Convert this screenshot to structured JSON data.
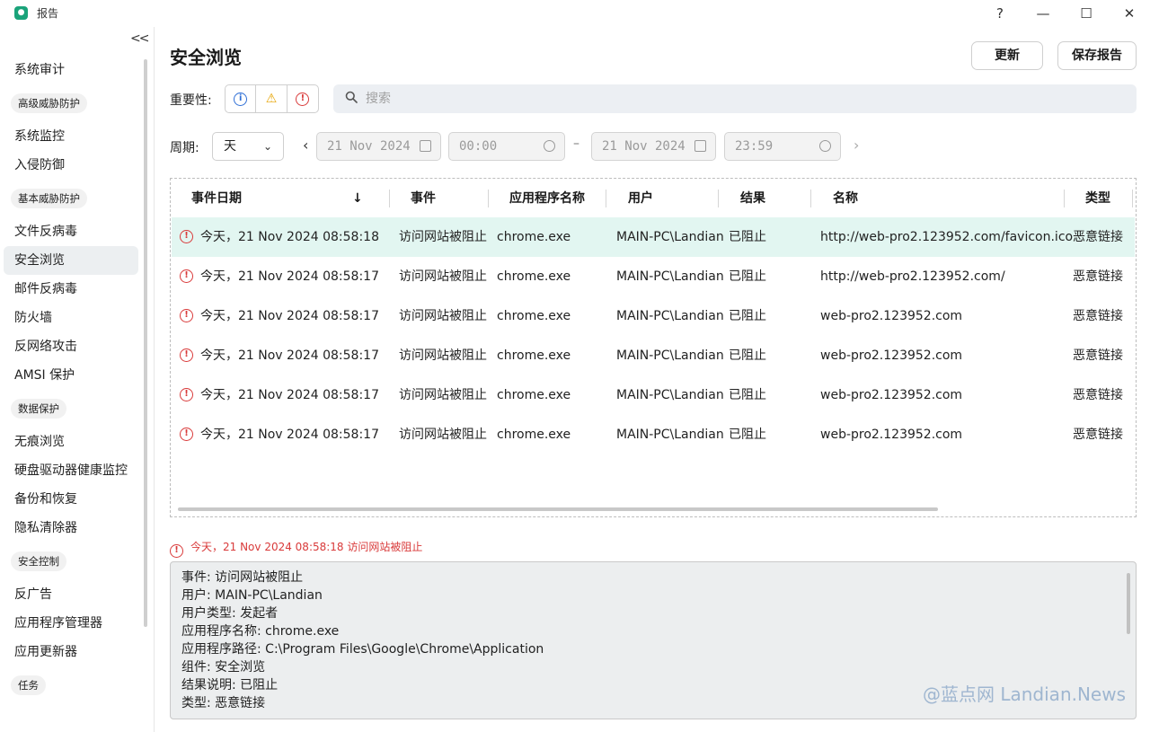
{
  "window": {
    "title": "报告",
    "help": "?",
    "minimize": "—",
    "maximize": "☐",
    "close": "✕"
  },
  "sidebar": {
    "collapse": "<<",
    "items": [
      {
        "type": "item",
        "label": "系统审计"
      },
      {
        "type": "group",
        "label": "高级威胁防护"
      },
      {
        "type": "item",
        "label": "系统监控"
      },
      {
        "type": "item",
        "label": "入侵防御"
      },
      {
        "type": "group",
        "label": "基本威胁防护"
      },
      {
        "type": "item",
        "label": "文件反病毒"
      },
      {
        "type": "item",
        "label": "安全浏览",
        "active": true
      },
      {
        "type": "item",
        "label": "邮件反病毒"
      },
      {
        "type": "item",
        "label": "防火墙"
      },
      {
        "type": "item",
        "label": "反网络攻击"
      },
      {
        "type": "item",
        "label": "AMSI 保护"
      },
      {
        "type": "group",
        "label": "数据保护"
      },
      {
        "type": "item",
        "label": "无痕浏览"
      },
      {
        "type": "item",
        "label": "硬盘驱动器健康监控"
      },
      {
        "type": "item",
        "label": "备份和恢复"
      },
      {
        "type": "item",
        "label": "隐私清除器"
      },
      {
        "type": "group",
        "label": "安全控制"
      },
      {
        "type": "item",
        "label": "反广告"
      },
      {
        "type": "item",
        "label": "应用程序管理器"
      },
      {
        "type": "item",
        "label": "应用更新器"
      },
      {
        "type": "group",
        "label": "任务"
      }
    ]
  },
  "main": {
    "title": "安全浏览",
    "refresh_label": "更新",
    "save_label": "保存报告",
    "severity_label": "重要性:",
    "severity_info": "i",
    "severity_warning": "⚠",
    "severity_error": "!",
    "search_placeholder": "搜索",
    "period_label": "周期:",
    "period_value": "天",
    "period_chevron": "⌄",
    "prev": "‹",
    "next": "›",
    "start_date": "21 Nov 2024",
    "start_time": "00:00",
    "end_date": "21 Nov 2024",
    "end_time": "23:59",
    "range_dash": "–"
  },
  "table": {
    "columns": {
      "date": "事件日期",
      "sort": "↓",
      "event": "事件",
      "app": "应用程序名称",
      "user": "用户",
      "result": "结果",
      "name": "名称",
      "type": "类型"
    },
    "rows": [
      {
        "date": "今天，21 Nov 2024 08:58:18",
        "event": "访问网站被阻止",
        "app": "chrome.exe",
        "user": "MAIN-PC\\Landian",
        "result": "已阻止",
        "name": "http://web-pro2.123952.com/favicon.ico",
        "type": "恶意链接"
      },
      {
        "date": "今天，21 Nov 2024 08:58:17",
        "event": "访问网站被阻止",
        "app": "chrome.exe",
        "user": "MAIN-PC\\Landian",
        "result": "已阻止",
        "name": "http://web-pro2.123952.com/",
        "type": "恶意链接"
      },
      {
        "date": "今天，21 Nov 2024 08:58:17",
        "event": "访问网站被阻止",
        "app": "chrome.exe",
        "user": "MAIN-PC\\Landian",
        "result": "已阻止",
        "name": "web-pro2.123952.com",
        "type": "恶意链接"
      },
      {
        "date": "今天，21 Nov 2024 08:58:17",
        "event": "访问网站被阻止",
        "app": "chrome.exe",
        "user": "MAIN-PC\\Landian",
        "result": "已阻止",
        "name": "web-pro2.123952.com",
        "type": "恶意链接"
      },
      {
        "date": "今天，21 Nov 2024 08:58:17",
        "event": "访问网站被阻止",
        "app": "chrome.exe",
        "user": "MAIN-PC\\Landian",
        "result": "已阻止",
        "name": "web-pro2.123952.com",
        "type": "恶意链接"
      },
      {
        "date": "今天，21 Nov 2024 08:58:17",
        "event": "访问网站被阻止",
        "app": "chrome.exe",
        "user": "MAIN-PC\\Landian",
        "result": "已阻止",
        "name": "web-pro2.123952.com",
        "type": "恶意链接"
      }
    ]
  },
  "detail": {
    "header": "今天，21 Nov 2024 08:58:18 访问网站被阻止",
    "lines": [
      "事件: 访问网站被阻止",
      "用户: MAIN-PC\\Landian",
      "用户类型: 发起者",
      "应用程序名称: chrome.exe",
      "应用程序路径: C:\\Program Files\\Google\\Chrome\\Application",
      "组件: 安全浏览",
      "结果说明: 已阻止",
      "类型: 恶意链接"
    ]
  },
  "watermark": "@蓝点网 Landian.News",
  "colors": {
    "selected_row": "#e2f6f1",
    "error": "#d93a3a",
    "info": "#2f6fd6",
    "warning": "#e6a300",
    "brand": "#1aa37a"
  }
}
